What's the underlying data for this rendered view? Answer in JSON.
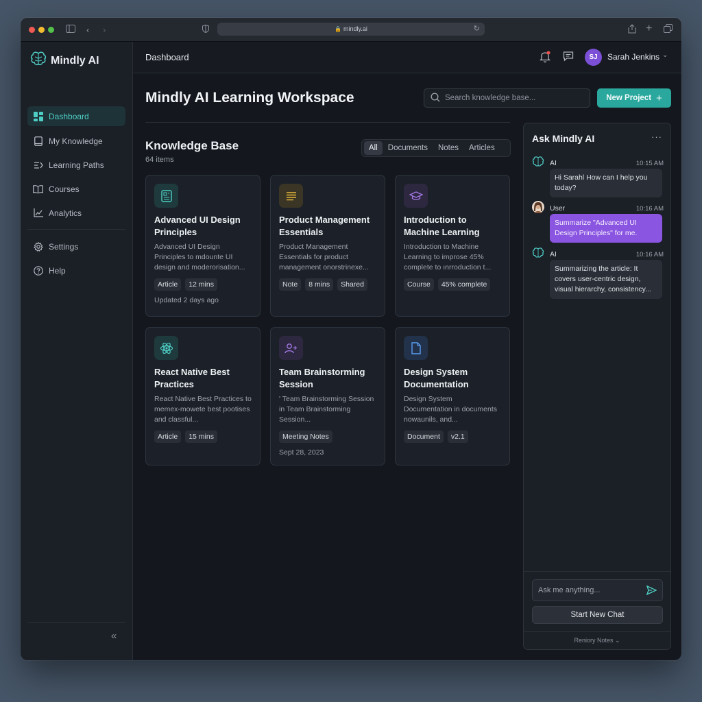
{
  "browser": {
    "url": "mindly.ai"
  },
  "sidebar": {
    "brand": "Mindly AI",
    "items": [
      {
        "label": "Dashboard",
        "icon": "dashboard-icon",
        "active": true
      },
      {
        "label": "My Knowledge",
        "icon": "book-icon"
      },
      {
        "label": "Learning Paths",
        "icon": "path-icon"
      },
      {
        "label": "Courses",
        "icon": "open-book-icon"
      },
      {
        "label": "Analytics",
        "icon": "chart-icon"
      },
      {
        "label": "Settings",
        "icon": "gear-icon"
      },
      {
        "label": "Help",
        "icon": "help-icon"
      }
    ]
  },
  "topbar": {
    "breadcrumb": "Dashboard",
    "user": {
      "initials": "SJ",
      "name": "Sarah Jenkins"
    }
  },
  "main": {
    "title": "Mindly AI Learning Workspace",
    "search_placeholder": "Search knowledge base...",
    "new_project_label": "New Project",
    "knowledge_base": {
      "title": "Knowledge Base",
      "count": "64 items",
      "filters": [
        "All",
        "Documents",
        "Notes",
        "Articles"
      ],
      "cards": [
        {
          "title": "Advanced UI Design Principles",
          "desc": "Advanced UI Design Principles to mdounte UI design and moderorisation...",
          "tags": [
            "Article",
            "12 mins"
          ],
          "meta": "Updated 2 days ago",
          "icon": "document-icon",
          "icon_color": "#4ecdc4",
          "icon_bg": "#1f3a3c"
        },
        {
          "title": "Product Management Essentials",
          "desc": "Product Management Essentials for product management onorstrinexe...",
          "tags": [
            "Note",
            "8 mins",
            "Shared"
          ],
          "meta": "",
          "icon": "note-lines-icon",
          "icon_color": "#e6b93b",
          "icon_bg": "#3a3524"
        },
        {
          "title": "Introduction to Machine Learning",
          "desc": "Introduction to Machine Learning to improse 45% complete to ınrroduction t...",
          "tags": [
            "Course",
            "45% complete"
          ],
          "meta": "",
          "icon": "graduation-cap-icon",
          "icon_color": "#a47be8",
          "icon_bg": "#2e2740"
        },
        {
          "title": "React Native Best Practices",
          "desc": "React Native Best Practices to memex-mowete best pootises and classful...",
          "tags": [
            "Article",
            "15 mins"
          ],
          "meta": "",
          "icon": "atom-icon",
          "icon_color": "#4ecdc4",
          "icon_bg": "#1f3a3c"
        },
        {
          "title": "Team Brainstorming Session",
          "desc": "' Team Brainstorming Session in Team Brainstorming Session...",
          "tags": [
            "Meeting Notes"
          ],
          "meta": "Sept 28, 2023",
          "icon": "users-icon",
          "icon_color": "#a47be8",
          "icon_bg": "#2e2740"
        },
        {
          "title": "Design System Documentation",
          "desc": "Design System Documentation in documents nowaunils, and...",
          "tags": [
            "Document",
            "v2.1"
          ],
          "meta": "",
          "icon": "file-icon",
          "icon_color": "#5b9cf0",
          "icon_bg": "#22324a"
        }
      ]
    }
  },
  "chat": {
    "title": "Ask Mindly AI",
    "messages": [
      {
        "sender": "AI",
        "time": "10:15 AM",
        "text": "Hi Sarahl How can I help you today?"
      },
      {
        "sender": "User",
        "time": "10:16 AM",
        "text": "Summarize \"Advanced UI Design Principles\" for me."
      },
      {
        "sender": "AI",
        "time": "10:16 AM",
        "text": "Summarizing the article: It covers user-centric design, visual hierarchy, consistency..."
      }
    ],
    "input_placeholder": "Ask me anything...",
    "new_chat_label": "Start New Chat",
    "footer_label": "Reniory Notes"
  },
  "colors": {
    "accent": "#2aa89e",
    "accent_text": "#4ecdc4",
    "user_bubble": "#8a55e0",
    "avatar": "#7b4fd6"
  }
}
